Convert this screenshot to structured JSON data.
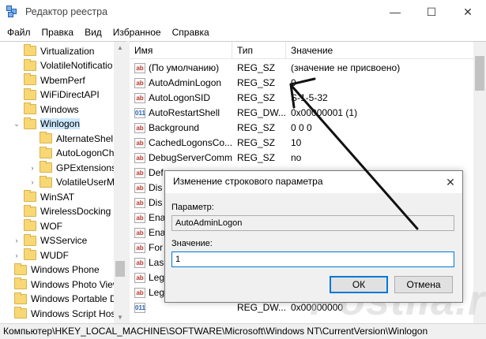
{
  "window": {
    "title": "Редактор реестра",
    "controls": [
      "—",
      "☐",
      "✕"
    ]
  },
  "menu": [
    "Файл",
    "Правка",
    "Вид",
    "Избранное",
    "Справка"
  ],
  "tree": [
    {
      "label": "Virtualization",
      "level": 1,
      "expander": ""
    },
    {
      "label": "VolatileNotificatio",
      "level": 1,
      "expander": ""
    },
    {
      "label": "WbemPerf",
      "level": 1,
      "expander": ""
    },
    {
      "label": "WiFiDirectAPI",
      "level": 1,
      "expander": ""
    },
    {
      "label": "Windows",
      "level": 1,
      "expander": ""
    },
    {
      "label": "Winlogon",
      "level": 1,
      "expander": "v",
      "selected": true
    },
    {
      "label": "AlternateShel",
      "level": 2,
      "expander": ""
    },
    {
      "label": "AutoLogonCh",
      "level": 2,
      "expander": ""
    },
    {
      "label": "GPExtensions",
      "level": 2,
      "expander": ">"
    },
    {
      "label": "VolatileUserM",
      "level": 2,
      "expander": ">"
    },
    {
      "label": "WinSAT",
      "level": 1,
      "expander": ""
    },
    {
      "label": "WirelessDocking",
      "level": 1,
      "expander": ""
    },
    {
      "label": "WOF",
      "level": 1,
      "expander": ""
    },
    {
      "label": "WSService",
      "level": 1,
      "expander": ">"
    },
    {
      "label": "WUDF",
      "level": 1,
      "expander": ">"
    },
    {
      "label": "Windows Phone",
      "level": 0,
      "expander": ""
    },
    {
      "label": "Windows Photo Viewer",
      "level": 0,
      "expander": ""
    },
    {
      "label": "Windows Portable Devic",
      "level": 0,
      "expander": ""
    },
    {
      "label": "Windows Script Host",
      "level": 0,
      "expander": ""
    }
  ],
  "columns": {
    "name": "Имя",
    "type": "Тип",
    "value": "Значение"
  },
  "values": [
    {
      "name": "(По умолчанию)",
      "type": "REG_SZ",
      "data": "(значение не присвоено)",
      "icon": "ab"
    },
    {
      "name": "AutoAdminLogon",
      "type": "REG_SZ",
      "data": "0",
      "icon": "ab"
    },
    {
      "name": "AutoLogonSID",
      "type": "REG_SZ",
      "data": "S-1-5-32",
      "icon": "ab"
    },
    {
      "name": "AutoRestartShell",
      "type": "REG_DW...",
      "data": "0x00000001 (1)",
      "icon": "bin"
    },
    {
      "name": "Background",
      "type": "REG_SZ",
      "data": "0 0 0",
      "icon": "ab"
    },
    {
      "name": "CachedLogonsCo...",
      "type": "REG_SZ",
      "data": "10",
      "icon": "ab"
    },
    {
      "name": "DebugServerComm...",
      "type": "REG_SZ",
      "data": "no",
      "icon": "ab"
    },
    {
      "name": "Def",
      "type": "",
      "data": "",
      "icon": "ab"
    },
    {
      "name": "Dis",
      "type": "",
      "data": "",
      "icon": "ab"
    },
    {
      "name": "Dis",
      "type": "",
      "data": "",
      "icon": "ab"
    },
    {
      "name": "Ena",
      "type": "",
      "data": "",
      "icon": "ab"
    },
    {
      "name": "Ena",
      "type": "",
      "data": "",
      "icon": "ab"
    },
    {
      "name": "For",
      "type": "",
      "data": "",
      "icon": "ab"
    },
    {
      "name": "Las",
      "type": "",
      "data": "",
      "icon": "ab"
    },
    {
      "name": "Leg",
      "type": "",
      "data": "",
      "icon": "ab"
    },
    {
      "name": "Leg",
      "type": "",
      "data": "",
      "icon": "ab"
    },
    {
      "name": "",
      "type": "REG_DW...",
      "data": "0x00000000",
      "icon": "bin"
    }
  ],
  "statusbar": "Компьютер\\HKEY_LOCAL_MACHINE\\SOFTWARE\\Microsoft\\Windows NT\\CurrentVersion\\Winlogon",
  "dialog": {
    "title": "Изменение строкового параметра",
    "close": "✕",
    "param_label": "Параметр:",
    "param_value": "AutoAdminLogon",
    "value_label": "Значение:",
    "value_value": "1",
    "ok": "ОК",
    "cancel": "Отмена"
  },
  "watermark": "Postila.ru",
  "colors": {
    "selection": "#cce8ff",
    "folder": "#f8d775",
    "focus": "#0078d7"
  }
}
